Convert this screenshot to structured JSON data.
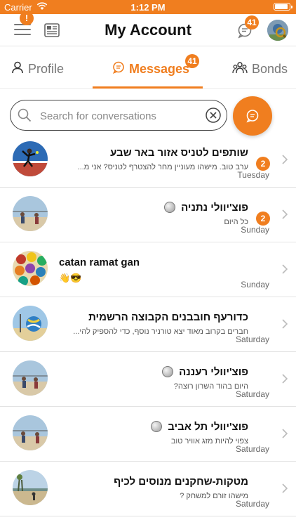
{
  "status_bar": {
    "carrier": "Carrier",
    "time": "1:12 PM"
  },
  "header": {
    "title": "My Account",
    "alert_badge": "!",
    "messages_badge": "41",
    "icons": [
      "menu-icon",
      "newspaper-icon",
      "chat-icon",
      "profile-avatar"
    ]
  },
  "tabs": [
    {
      "label": "Profile",
      "icon": "person-icon",
      "active": false
    },
    {
      "label": "Messages",
      "icon": "chat-icon",
      "active": true,
      "badge": "41"
    },
    {
      "label": "Bonds",
      "icon": "people-icon",
      "active": false
    }
  ],
  "search": {
    "placeholder": "Search for conversations",
    "value": ""
  },
  "colors": {
    "accent": "#f07e1f",
    "text": "#111111",
    "muted": "#666666"
  },
  "conversations": [
    {
      "name": "שותפים לטניס אזור באר שבע",
      "preview": "ערב טוב. מישהו מעוניין מחר להצטרף לטניס? אני מ...",
      "day": "Tuesday",
      "unread": "2"
    },
    {
      "name": "פוצ'יוולי נתניה",
      "preview": "כל היום",
      "day": "Sunday",
      "unread": "2"
    },
    {
      "name": "catan ramat gan",
      "preview": "👋😎",
      "day": "Sunday",
      "unread": ""
    },
    {
      "name": "כדורעף חובבנים הקבוצה הרשמית",
      "preview": "חברים בקרוב מאוד יצא טורניר נוסף, כדי להספיק להי...",
      "day": "Saturday",
      "unread": ""
    },
    {
      "name": "פוצ'יוולי רעננה",
      "preview": "היום בהוד השרון רוצה?",
      "day": "Saturday",
      "unread": ""
    },
    {
      "name": "פוצ'יוולי תל אביב",
      "preview": "צפוי להיות מזג אוויר טוב",
      "day": "Saturday",
      "unread": ""
    },
    {
      "name": "מטקות-שחקנים מנוסים לכיף",
      "preview": "מישהו זורם למשחק ?",
      "day": "Saturday",
      "unread": ""
    }
  ]
}
